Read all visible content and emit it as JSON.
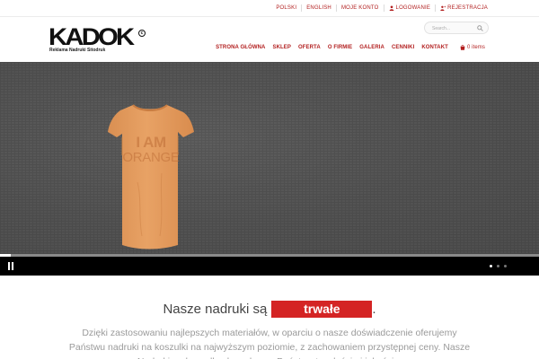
{
  "topbar": {
    "links": [
      {
        "label": "POLSKI"
      },
      {
        "label": "ENGLISH"
      },
      {
        "label": "MOJE KONTO"
      },
      {
        "label": "LOGOWANIE"
      },
      {
        "label": "REJESTRACJA"
      }
    ]
  },
  "header": {
    "logo_word": "KADOK",
    "logo_mark": "c",
    "logo_tagline": "Reklama Nadruki Sitodruk",
    "search_placeholder": "Search...",
    "nav": [
      {
        "label": "STRONA GŁÓWNA"
      },
      {
        "label": "SKLEP"
      },
      {
        "label": "OFERTA"
      },
      {
        "label": "O FIRMIE"
      },
      {
        "label": "GALERIA"
      },
      {
        "label": "CENNIKI"
      },
      {
        "label": "KONTAKT"
      }
    ],
    "cart_label": "0 items"
  },
  "hero": {
    "shirt_line1": "I AM",
    "shirt_line2": "ORANGE",
    "shirt_color": "#e39c5c",
    "slide_progress_percent": 2,
    "slide_count": 3,
    "active_slide": 1
  },
  "content": {
    "headline_prefix": "Nasze nadruki są",
    "headline_highlight": "trwałe",
    "headline_suffix": ".",
    "paragraph": "Dzięki zastosowaniu najlepszych materiałów, w oparciu o nasze doświadczenie oferujemy Państwu nadruki na koszulki na najwyższym poziomie, z zachowaniem przystępnej ceny. Nasze Nadruki na koszulkach zaskoczą Państwa trwałością i jakością."
  },
  "colors": {
    "accent": "#b21f1f",
    "highlight_bg": "#d42424",
    "hero_bg": "#555555",
    "controls_bg": "#000000"
  }
}
